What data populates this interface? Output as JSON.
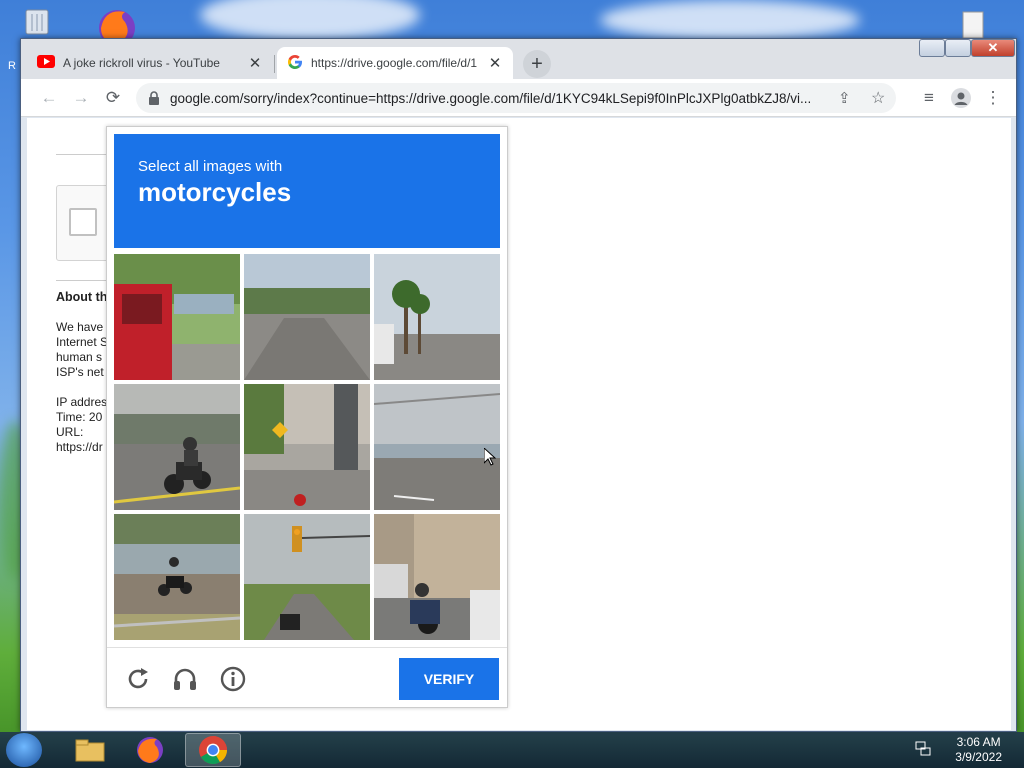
{
  "desktop": {
    "recycle_bin_letter": "R"
  },
  "browser": {
    "tabs": [
      {
        "title": "A joke rickroll virus - YouTube",
        "active": false
      },
      {
        "title": "https://drive.google.com/file/d/1",
        "active": true
      }
    ],
    "address": "google.com/sorry/index?continue=https://drive.google.com/file/d/1KYC94kLSepi9f0InPlcJXPlg0atbkZJ8/vi...",
    "accent": "#1a73e8"
  },
  "page": {
    "about_heading": "About th",
    "lines": [
      "We have",
      "Internet S",
      "human s",
      "ISP's net",
      "",
      "IP addres",
      "Time: 20",
      "URL:",
      "https://dr"
    ]
  },
  "captcha": {
    "instruction": "Select all images with",
    "target": "motorcycles",
    "verify_label": "VERIFY",
    "tiles": [
      "red-truck-parking-lot",
      "empty-road-trees",
      "palm-trees-street",
      "motorcyclist-intersection",
      "storefront-traffic-sign",
      "bridge-road",
      "motorcyclist-highway",
      "traffic-light-road",
      "motorcycle-city-street"
    ]
  },
  "taskbar": {
    "time": "3:06 AM",
    "date": "3/9/2022"
  }
}
